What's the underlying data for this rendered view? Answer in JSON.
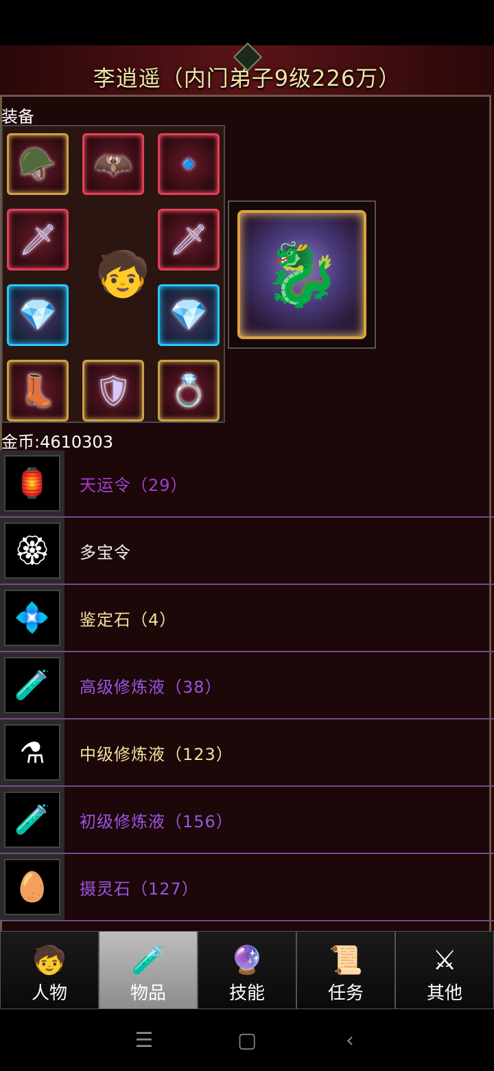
{
  "header": {
    "title": "李逍遥（内门弟子9级226万）"
  },
  "equipment": {
    "label": "装备",
    "slots": [
      {
        "icon": "helmet-icon",
        "glyph": "🪖",
        "style": "gold"
      },
      {
        "icon": "wings-icon",
        "glyph": "🦇",
        "style": "red"
      },
      {
        "icon": "amulet-icon",
        "glyph": "🔹",
        "style": "red"
      },
      {
        "icon": "sword-icon",
        "glyph": "🗡",
        "style": "red"
      },
      {
        "icon": "sword-icon",
        "glyph": "🗡",
        "style": "red"
      },
      {
        "icon": "bracer-icon",
        "glyph": "💎",
        "style": "blue"
      },
      {
        "icon": "bracer-icon",
        "glyph": "💎",
        "style": "blue"
      },
      {
        "icon": "boots-icon",
        "glyph": "👢",
        "style": "gold"
      },
      {
        "icon": "armor-icon",
        "glyph": "🛡",
        "style": "gold"
      },
      {
        "icon": "ring-icon",
        "glyph": "💍",
        "style": "gold"
      }
    ],
    "avatar_glyph": "🧒",
    "pet_glyph": "🐉"
  },
  "gold": {
    "text": "金币:4610303"
  },
  "items": [
    {
      "name": "天运令（29）",
      "icon": "token-icon",
      "glyph": "🏮",
      "color": "purple"
    },
    {
      "name": "多宝令",
      "icon": "treasure-token-icon",
      "glyph": "🏵",
      "color": "white"
    },
    {
      "name": "鉴定石（4）",
      "icon": "gem-icon",
      "glyph": "💠",
      "color": "yellow"
    },
    {
      "name": "高级修炼液（38）",
      "icon": "potion-icon",
      "glyph": "🧪",
      "color": "violet"
    },
    {
      "name": "中级修炼液（123）",
      "icon": "potion-icon",
      "glyph": "⚗",
      "color": "yellow"
    },
    {
      "name": "初级修炼液（156）",
      "icon": "vial-icon",
      "glyph": "🧪",
      "color": "violet"
    },
    {
      "name": "摄灵石（127）",
      "icon": "egg-stone-icon",
      "glyph": "🥚",
      "color": "violet"
    }
  ],
  "tabs": [
    {
      "label": "人物",
      "glyph": "🧒",
      "icon": "character-icon",
      "active": false
    },
    {
      "label": "物品",
      "glyph": "🧪",
      "icon": "items-icon",
      "active": true
    },
    {
      "label": "技能",
      "glyph": "🔮",
      "icon": "skills-icon",
      "active": false
    },
    {
      "label": "任务",
      "glyph": "📜",
      "icon": "quests-icon",
      "active": false
    },
    {
      "label": "其他",
      "glyph": "⚔",
      "icon": "other-icon",
      "active": false
    }
  ],
  "navbar": {
    "menu_glyph": "☰",
    "home_glyph": "▢",
    "back_glyph": "‹"
  },
  "colors": {
    "purple": "#a23fd0",
    "white": "#f0f0f0",
    "yellow": "#f0e0a0",
    "violet": "#9a55e0"
  }
}
